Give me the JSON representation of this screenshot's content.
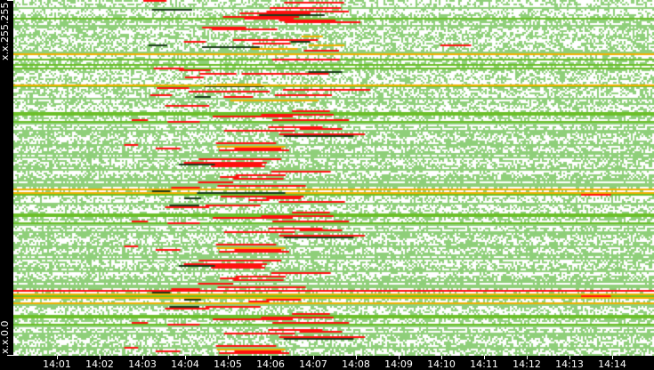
{
  "chart_data": {
    "type": "heatmap",
    "title": "",
    "xlabel": "",
    "ylabel": "",
    "y_tick_labels": [
      "x.x.255.255",
      "x.x.0.0"
    ],
    "x_tick_labels": [
      "14:01",
      "14:02",
      "14:03",
      "14:04",
      "14:05",
      "14:06",
      "14:07",
      "14:08",
      "14:09",
      "14:10",
      "14:11",
      "14:12",
      "14:13",
      "14:14"
    ],
    "xlim": [
      "14:00",
      "14:15"
    ],
    "grid": false,
    "colors": {
      "background": "#ffffff",
      "low": "#8fcf7a",
      "medium": "#6cbf2a",
      "high": "#f0b000",
      "peak": "#ff1010",
      "dark": "#1a3a1a"
    },
    "peak_activity_window": [
      "14:05",
      "14:08"
    ]
  }
}
